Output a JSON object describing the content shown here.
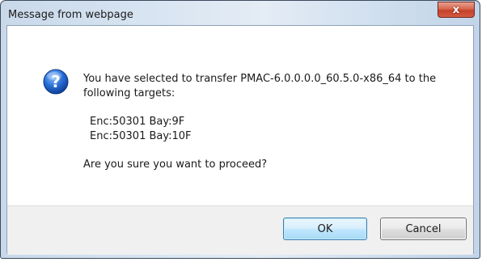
{
  "dialog": {
    "title": "Message from webpage",
    "close_label": "x",
    "icon": "question-icon",
    "message_lines": [
      "You have selected to transfer PMAC-6.0.0.0.0_60.5.0-x86_64 to the",
      "following targets:"
    ],
    "targets": [
      "Enc:50301 Bay:9F",
      "Enc:50301 Bay:10F"
    ],
    "confirm_text": "Are you sure you want to proceed?",
    "ok_label": "OK",
    "cancel_label": "Cancel"
  },
  "colors": {
    "frame": "#d7e4f1",
    "close_button": "#c5402a",
    "icon_blue": "#1f5fbf",
    "ok_border": "#3c7fb1"
  }
}
